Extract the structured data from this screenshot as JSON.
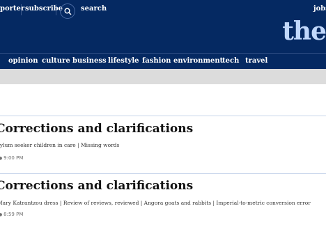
{
  "header": {
    "top_links": [
      {
        "label": "porter"
      },
      {
        "label": "subscribe"
      },
      {
        "label": "search"
      },
      {
        "label": "jobs"
      }
    ],
    "logo": "the"
  },
  "nav": {
    "items": [
      {
        "label": "opinion"
      },
      {
        "label": "culture"
      },
      {
        "label": "business"
      },
      {
        "label": "lifestyle"
      },
      {
        "label": "fashion"
      },
      {
        "label": "environment"
      },
      {
        "label": "tech"
      },
      {
        "label": "travel"
      }
    ]
  },
  "articles": [
    {
      "title": "Corrections and clarifications",
      "subtitle": "sylum seeker children in care | Missing words",
      "time": "9:00 PM"
    },
    {
      "title": "Corrections and clarifications",
      "subtitle": "Mary Katrantzou dress | Review of reviews, reviewed | Angora goats and rabbits | Imperial-to-metric conversion error",
      "time": "8:59 PM"
    }
  ]
}
